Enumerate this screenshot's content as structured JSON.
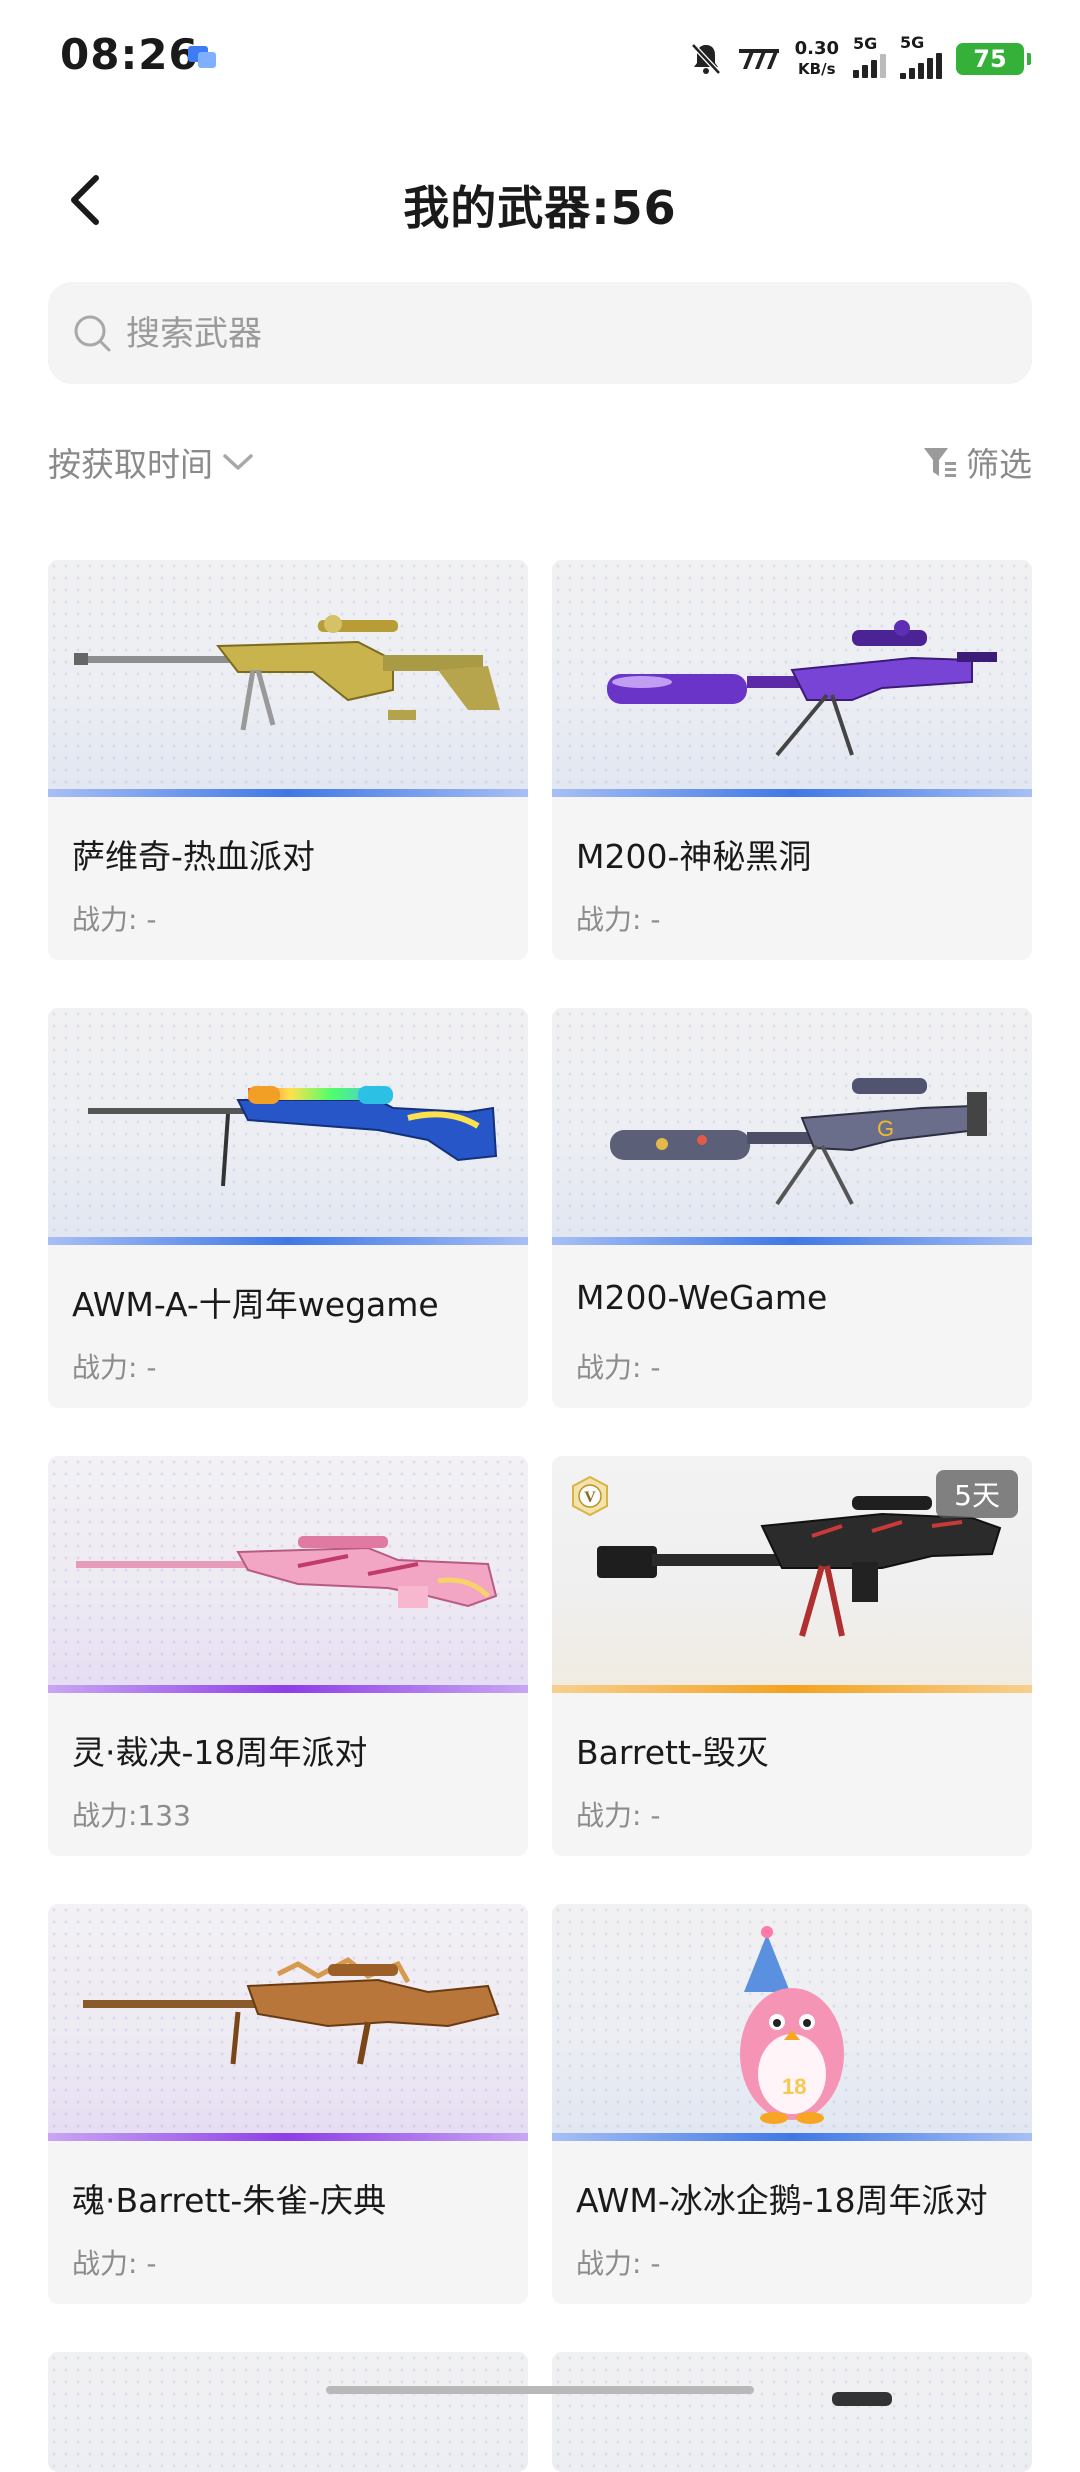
{
  "status_bar": {
    "time": "08:26",
    "speed_value": "0.30",
    "speed_unit": "KB/s",
    "sim1": "5G",
    "sim2": "5G",
    "battery": "75"
  },
  "header": {
    "title": "我的武器:56"
  },
  "search": {
    "placeholder": "搜索武器",
    "value": ""
  },
  "toolbar": {
    "sort_label": "按获取时间",
    "filter_label": "筛选"
  },
  "cards": [
    {
      "name": "萨维奇-热血派对",
      "power": "战力: -",
      "rarity": "blue"
    },
    {
      "name": "M200-神秘黑洞",
      "power": "战力: -",
      "rarity": "blue"
    },
    {
      "name": "AWM-A-十周年wegame",
      "power": "战力: -",
      "rarity": "blue"
    },
    {
      "name": "M200-WeGame",
      "power": "战力: -",
      "rarity": "blue"
    },
    {
      "name": "灵·裁决-18周年派对",
      "power": "战力:133",
      "rarity": "purple"
    },
    {
      "name": "Barrett-毁灭",
      "power": "战力: -",
      "rarity": "gold",
      "badge": "5天",
      "vip_icon": "V"
    },
    {
      "name": "魂·Barrett-朱雀-庆典",
      "power": "战力: -",
      "rarity": "purple"
    },
    {
      "name": "AWM-冰冰企鹅-18周年派对",
      "power": "战力: -",
      "rarity": "blue"
    }
  ],
  "colors": {
    "blue_rarity": "#3f78e6",
    "purple_rarity": "#8d3ee8",
    "gold_rarity": "#f4a21e",
    "battery": "#35b13a"
  },
  "icons": [
    "message-icon",
    "mute-icon",
    "hd-icon",
    "signal-icon",
    "back-icon",
    "search-icon",
    "chevron-down-icon",
    "filter-icon"
  ]
}
